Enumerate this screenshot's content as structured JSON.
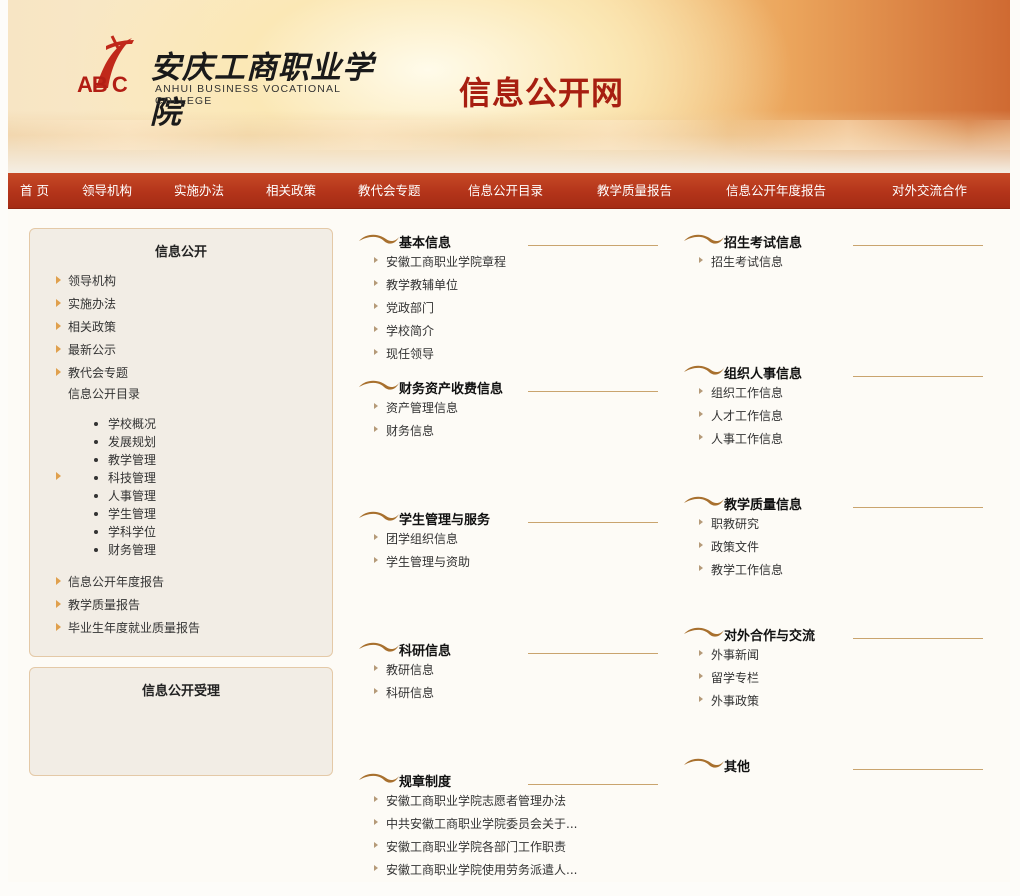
{
  "header": {
    "logo_cn": "安庆工商职业学院",
    "logo_en": "ANHUI BUSINESS VOCATIONAL COLLEGE",
    "logo_abc": "AB C",
    "site_title": "信息公开网"
  },
  "nav": [
    "首 页",
    "领导机构",
    "实施办法",
    "相关政策",
    "教代会专题",
    "信息公开目录",
    "教学质量报告",
    "信息公开年度报告",
    "对外交流合作"
  ],
  "sidebar": {
    "panel_title": "信息公开",
    "items_top": [
      "领导机构",
      "实施办法",
      "相关政策",
      "最新公示",
      "教代会专题"
    ],
    "catalog_label": "信息公开目录",
    "catalog_items": [
      "学校概况",
      "发展规划",
      "教学管理",
      "科技管理",
      "人事管理",
      "学生管理",
      "学科学位",
      "财务管理"
    ],
    "items_bottom": [
      "信息公开年度报告",
      "教学质量报告",
      "毕业生年度就业质量报告"
    ],
    "panel2_title": "信息公开受理"
  },
  "sections": {
    "basic": {
      "title": "基本信息",
      "items": [
        "安徽工商职业学院章程",
        "教学教辅单位",
        "党政部门",
        "学校简介",
        "现任领导"
      ]
    },
    "finance": {
      "title": "财务资产收费信息",
      "items": [
        "资产管理信息",
        "财务信息"
      ]
    },
    "student": {
      "title": "学生管理与服务",
      "items": [
        "团学组织信息",
        "学生管理与资助"
      ]
    },
    "research": {
      "title": "科研信息",
      "items": [
        "教研信息",
        "科研信息"
      ]
    },
    "rules": {
      "title": "规章制度",
      "items": [
        "安徽工商职业学院志愿者管理办法",
        "中共安徽工商职业学院委员会关于...",
        "安徽工商职业学院各部门工作职责",
        "安徽工商职业学院使用劳务派遣人..."
      ]
    },
    "admission": {
      "title": "招生考试信息",
      "items": [
        "招生考试信息"
      ]
    },
    "personnel": {
      "title": "组织人事信息",
      "items": [
        "组织工作信息",
        "人才工作信息",
        "人事工作信息"
      ]
    },
    "quality": {
      "title": "教学质量信息",
      "items": [
        "职教研究",
        "政策文件",
        "教学工作信息"
      ]
    },
    "external": {
      "title": "对外合作与交流",
      "items": [
        "外事新闻",
        "留学专栏",
        "外事政策"
      ]
    },
    "other": {
      "title": "其他",
      "items": []
    }
  },
  "colors": {
    "nav_red": "#b3341a",
    "title_red": "#a71e10",
    "accent_gold": "#e0a04d"
  }
}
